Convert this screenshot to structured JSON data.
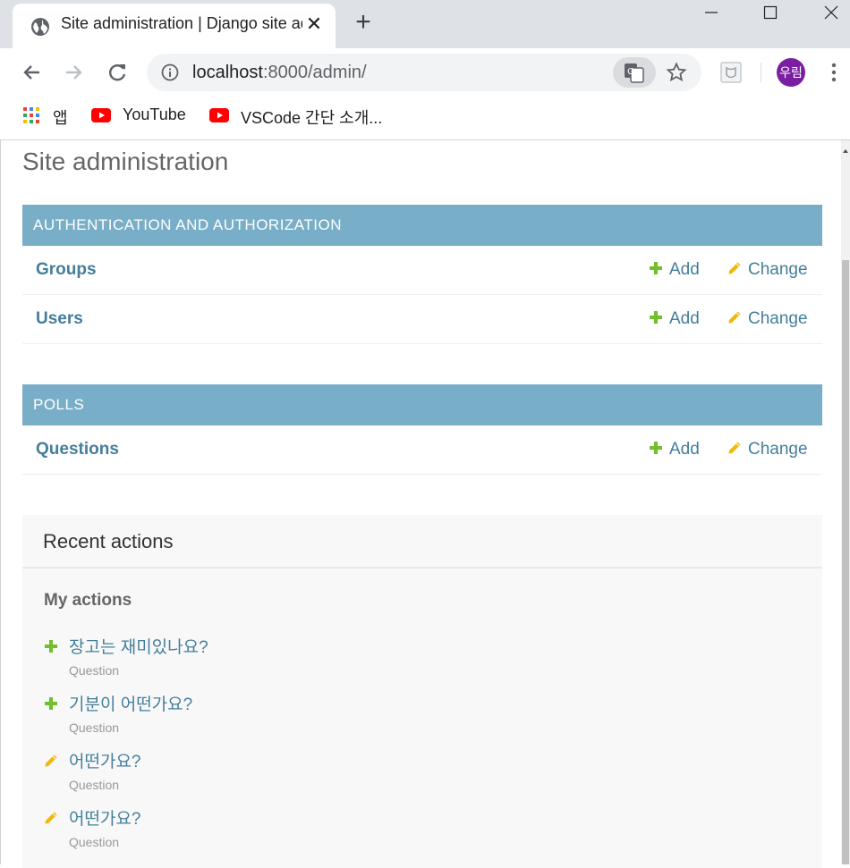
{
  "browser": {
    "tab_title": "Site administration | Django site admin",
    "url_host": "localhost",
    "url_rest": ":8000/admin/",
    "profile_initials": "우림",
    "bookmarks": [
      {
        "label": "앱",
        "icon": "apps-grid-icon"
      },
      {
        "label": "YouTube",
        "icon": "youtube-icon"
      },
      {
        "label": "VSCode 간단 소개...",
        "icon": "youtube-icon"
      }
    ]
  },
  "page": {
    "title": "Site administration",
    "modules": [
      {
        "caption": "AUTHENTICATION AND AUTHORIZATION",
        "models": [
          {
            "name": "Groups",
            "add_label": "Add",
            "change_label": "Change"
          },
          {
            "name": "Users",
            "add_label": "Add",
            "change_label": "Change"
          }
        ]
      },
      {
        "caption": "POLLS",
        "models": [
          {
            "name": "Questions",
            "add_label": "Add",
            "change_label": "Change"
          }
        ]
      }
    ],
    "recent": {
      "title": "Recent actions",
      "subtitle": "My actions",
      "actions": [
        {
          "kind": "add",
          "text": "장고는 재미있나요?",
          "type": "Question"
        },
        {
          "kind": "add",
          "text": "기분이 어떤가요?",
          "type": "Question"
        },
        {
          "kind": "change",
          "text": "어떤가요?",
          "type": "Question"
        },
        {
          "kind": "change",
          "text": "어떤가요?",
          "type": "Question"
        }
      ]
    }
  },
  "colors": {
    "module_header": "#79aec8",
    "link": "#447e9b",
    "add_icon": "#70bf2b",
    "change_icon": "#efb80b",
    "avatar": "#7b1fa2",
    "youtube_red": "#ff0000"
  }
}
